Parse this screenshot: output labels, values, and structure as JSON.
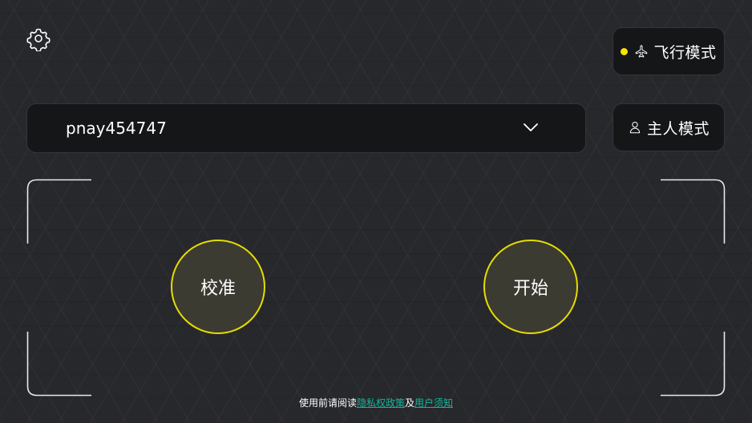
{
  "settings": {
    "icon": "gear-icon"
  },
  "flight_mode": {
    "label": "飞行模式",
    "icon": "airplane-icon",
    "indicator_color": "#f5e400"
  },
  "owner_mode": {
    "label": "主人模式",
    "icon": "person-icon"
  },
  "device_select": {
    "value": "pnay454747",
    "icon": "chevron-down-icon"
  },
  "controls": {
    "calibrate_label": "校准",
    "start_label": "开始",
    "ring_color": "#e6dc00"
  },
  "footer": {
    "prefix": "使用前请阅读",
    "privacy_link": "隐私权政策",
    "conjunction": "及",
    "terms_link": "用户须知",
    "link_color": "#19b39a"
  }
}
